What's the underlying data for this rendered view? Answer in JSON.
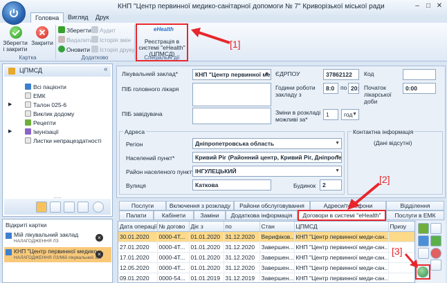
{
  "window": {
    "title": "КНП \"Центр первинної медико-санітарної допомоги № 7\" Криворізької міської ради"
  },
  "ribbon": {
    "tabs": [
      "Головна",
      "Вигляд",
      "Друк"
    ],
    "groups": {
      "card": {
        "label": "Картка",
        "save_close": "Зберегти і закрити",
        "close": "Закрити"
      },
      "extra": {
        "label": "Додатково",
        "save": "Зберегти",
        "delete": "Видалити",
        "refresh": "Оновити",
        "audit": "Аудит",
        "history_changes": "Історія змін",
        "history_print": "Історія друку"
      },
      "special": {
        "label": "Спеціальні дії",
        "register_ehealth": "Реєстрація в системі \"eHealth\" (ЦПМСД)",
        "ehealth_logo": "eHealth"
      }
    }
  },
  "callouts": {
    "c1": "[1]",
    "c2": "[2]",
    "c3": "[3]"
  },
  "nav": {
    "title": "ЦПМСД",
    "items": [
      "Всі пацієнти",
      "ЕМК",
      "Талон 025-6",
      "Виклик додому",
      "Рецепти",
      "Імунізації",
      "Листки непрацездатності"
    ],
    "handle": "....."
  },
  "open_cards": {
    "title": "Відкриті картки",
    "items": [
      {
        "title": "Мій лікувальний заклад",
        "subtitle": "НАЛАГОДЖЕННЯ ЛЗ"
      },
      {
        "title": "КНП \"Центр первинної медико-...",
        "subtitle": "НАЛАГОДЖЕННЯ ЛЗ/Мій лікувальний зак"
      }
    ]
  },
  "form": {
    "facility_label": "Лікувальний заклад*",
    "facility_value": "КНП \"Центр первинної ме,",
    "edrpou_label": "ЄДРПОУ",
    "edrpou_value": "37862122",
    "code_label": "Код",
    "code_value": "",
    "chief_label": "ПІБ головного лікаря",
    "hours_label": "Години роботи закладу з",
    "hours_from": "8:0",
    "hours_to_label": "по",
    "hours_to": "20:",
    "sick_start_label": "Початок лікарської доби",
    "sick_start_value": "0:00",
    "manager_label": "ПІБ завідувача",
    "shift_label": "Зміни в розкладі можливі за*",
    "shift_value": "1",
    "shift_unit": "год",
    "address_group": "Адреса",
    "contact_group": "Контактна інформація",
    "contact_empty": "(Дані відсутні)",
    "region_label": "Регіон",
    "region_value": "Дніпропетровська область",
    "city_label": "Населений пункт*",
    "city_value": "Кривий Ріг (Районний центр, Кривий Ріг, Дніпропетр",
    "district_label": "Район населеного пункту",
    "district_value": "ІНГУЛЕЦЬКИЙ",
    "street_label": "Вулиця",
    "street_value": "Каткова",
    "building_label": "Будинок",
    "building_value": "2"
  },
  "tabs_row1": [
    "Послуги",
    "Включення з розкладу",
    "Райони обслуговування",
    "Адреси/телефони",
    "Відділення"
  ],
  "tabs_row2": [
    "Палати",
    "Кабінети",
    "Заміни",
    "Додаткова інформація",
    "Договори в системі \"eHealth\"",
    "Послуги в ЕМК"
  ],
  "grid": {
    "columns": [
      "Дата операції",
      "№ догово",
      "Діє з",
      "по",
      "Стан",
      "ЦПМСД",
      "Призу"
    ],
    "rows": [
      [
        "30.01.2020",
        "0000-4Т...",
        "01.01.2020",
        "31.12.2020",
        "Верифіков...",
        "КНП \"Центр первинної меди-сан...",
        ""
      ],
      [
        "27.01.2020",
        "0000-4Т...",
        "01.01.2020",
        "31.12.2020",
        "Завершен...",
        "КНП \"Центр первинної меди-сан...",
        ""
      ],
      [
        "17.01.2020",
        "0000-4Т...",
        "01.01.2020",
        "31.12.2020",
        "Завершен...",
        "КНП \"Центр первинної меди-сан...",
        ""
      ],
      [
        "12.05.2020",
        "0000-4Т...",
        "01.01.2020",
        "31.12.2020",
        "Завершен...",
        "КНП \"Центр первинної меди-сан...",
        ""
      ],
      [
        "09.01.2020",
        "0000-54...",
        "01.01.2019",
        "31.12.2019",
        "Завершен...",
        "КНП \"Центр первинної меди-сан...",
        ""
      ]
    ]
  }
}
